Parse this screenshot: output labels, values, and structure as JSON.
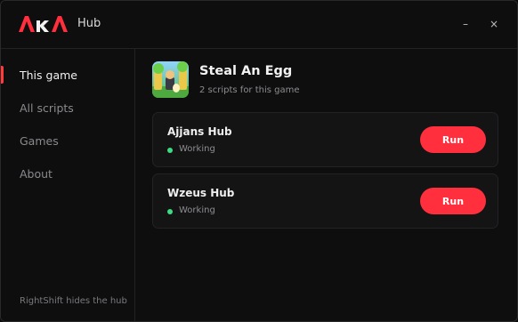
{
  "app": {
    "logo_text": "AKA",
    "title": "Hub",
    "accent_color": "#ff2f3d",
    "minimize_glyph": "–",
    "close_glyph": "×"
  },
  "sidebar": {
    "items": [
      {
        "label": "This game",
        "active": true
      },
      {
        "label": "All scripts",
        "active": false
      },
      {
        "label": "Games",
        "active": false
      },
      {
        "label": "About",
        "active": false
      }
    ],
    "hint": "RightShift hides the hub"
  },
  "game": {
    "title": "Steal An Egg",
    "subtitle": "2 scripts for this game"
  },
  "scripts": [
    {
      "name": "Ajjans Hub",
      "status": "Working",
      "status_color": "#3ddc84",
      "button_label": "Run"
    },
    {
      "name": "Wzeus Hub",
      "status": "Working",
      "status_color": "#3ddc84",
      "button_label": "Run"
    }
  ]
}
